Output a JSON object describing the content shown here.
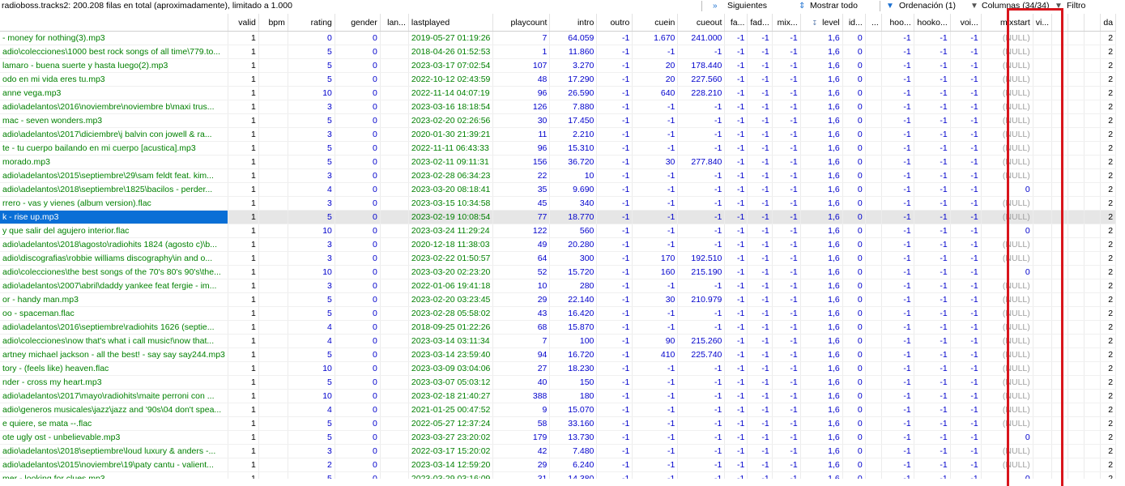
{
  "toolbar": {
    "status": "radioboss.tracks2: 200.208 filas en total (aproximadamente), limitado a 1.000",
    "next_label": "Siguientes",
    "show_all_label": "Mostrar todo",
    "sort_label": "Ordenación (1)",
    "columns_label": "Columnas (34/34)",
    "filter_label": "Filtro",
    "next_icon": "double-chevron-right-icon",
    "show_all_icon": "up-down-arrows-icon",
    "sort_icon": "funnel-icon",
    "columns_icon": "dropdown-triangle-icon",
    "filter_icon": "dropdown-triangle-icon"
  },
  "colors": {
    "accent_highlight": "#d9151c",
    "selection": "#0a6fd6",
    "text_filename": "#008000",
    "text_number": "#0000cc",
    "null_text": "#a0a0a0"
  },
  "columns": [
    "",
    "valid",
    "bpm",
    "rating",
    "gender",
    "lan...",
    "lastplayed",
    "playcount",
    "intro",
    "outro",
    "cuein",
    "cueout",
    "fa...",
    "fad...",
    "mix...",
    "level",
    "id...",
    "...",
    "hoo...",
    "hooko...",
    "voi...",
    "mixstart",
    "vi...",
    "",
    "",
    "",
    "da"
  ],
  "level_sort_icon": "sort-za-icon",
  "rows": [
    [
      "- money for nothing(3).mp3",
      "1",
      "",
      "0",
      "0",
      "",
      "2019-05-27 01:19:26",
      "7",
      "64.059",
      "-1",
      "1.670",
      "241.000",
      "-1",
      "-1",
      "-1",
      "1,6",
      "0",
      "",
      "-1",
      "-1",
      "-1",
      "(NULL)",
      "",
      "",
      "",
      "",
      "2"
    ],
    [
      "adio\\colecciones\\1000 best rock songs of all time\\779.to...",
      "1",
      "",
      "5",
      "0",
      "",
      "2018-04-26 01:52:53",
      "1",
      "11.860",
      "-1",
      "-1",
      "-1",
      "-1",
      "-1",
      "-1",
      "1,6",
      "0",
      "",
      "-1",
      "-1",
      "-1",
      "(NULL)",
      "",
      "",
      "",
      "",
      "2"
    ],
    [
      "lamaro - buena suerte y hasta luego(2).mp3",
      "1",
      "",
      "5",
      "0",
      "",
      "2023-03-17 07:02:54",
      "107",
      "3.270",
      "-1",
      "20",
      "178.440",
      "-1",
      "-1",
      "-1",
      "1,6",
      "0",
      "",
      "-1",
      "-1",
      "-1",
      "(NULL)",
      "",
      "",
      "",
      "",
      "2"
    ],
    [
      "odo en mi vida eres tu.mp3",
      "1",
      "",
      "5",
      "0",
      "",
      "2022-10-12 02:43:59",
      "48",
      "17.290",
      "-1",
      "20",
      "227.560",
      "-1",
      "-1",
      "-1",
      "1,6",
      "0",
      "",
      "-1",
      "-1",
      "-1",
      "(NULL)",
      "",
      "",
      "",
      "",
      "2"
    ],
    [
      "anne vega.mp3",
      "1",
      "",
      "10",
      "0",
      "",
      "2022-11-14 04:07:19",
      "96",
      "26.590",
      "-1",
      "640",
      "228.210",
      "-1",
      "-1",
      "-1",
      "1,6",
      "0",
      "",
      "-1",
      "-1",
      "-1",
      "(NULL)",
      "",
      "",
      "",
      "",
      "2"
    ],
    [
      "adio\\adelantos\\2016\\noviembre\\noviembre b\\maxi trus...",
      "1",
      "",
      "3",
      "0",
      "",
      "2023-03-16 18:18:54",
      "126",
      "7.880",
      "-1",
      "-1",
      "-1",
      "-1",
      "-1",
      "-1",
      "1,6",
      "0",
      "",
      "-1",
      "-1",
      "-1",
      "(NULL)",
      "",
      "",
      "",
      "",
      "2"
    ],
    [
      "mac - seven wonders.mp3",
      "1",
      "",
      "5",
      "0",
      "",
      "2023-02-20 02:26:56",
      "30",
      "17.450",
      "-1",
      "-1",
      "-1",
      "-1",
      "-1",
      "-1",
      "1,6",
      "0",
      "",
      "-1",
      "-1",
      "-1",
      "(NULL)",
      "",
      "",
      "",
      "",
      "2"
    ],
    [
      "adio\\adelantos\\2017\\diciembre\\j balvin con jowell & ra...",
      "1",
      "",
      "3",
      "0",
      "",
      "2020-01-30 21:39:21",
      "11",
      "2.210",
      "-1",
      "-1",
      "-1",
      "-1",
      "-1",
      "-1",
      "1,6",
      "0",
      "",
      "-1",
      "-1",
      "-1",
      "(NULL)",
      "",
      "",
      "",
      "",
      "2"
    ],
    [
      "te - tu cuerpo bailando en mi cuerpo [acustica].mp3",
      "1",
      "",
      "5",
      "0",
      "",
      "2022-11-11 06:43:33",
      "96",
      "15.310",
      "-1",
      "-1",
      "-1",
      "-1",
      "-1",
      "-1",
      "1,6",
      "0",
      "",
      "-1",
      "-1",
      "-1",
      "(NULL)",
      "",
      "",
      "",
      "",
      "2"
    ],
    [
      "morado.mp3",
      "1",
      "",
      "5",
      "0",
      "",
      "2023-02-11 09:11:31",
      "156",
      "36.720",
      "-1",
      "30",
      "277.840",
      "-1",
      "-1",
      "-1",
      "1,6",
      "0",
      "",
      "-1",
      "-1",
      "-1",
      "(NULL)",
      "",
      "",
      "",
      "",
      "2"
    ],
    [
      "adio\\adelantos\\2015\\septiembre\\29\\sam feldt feat. kim...",
      "1",
      "",
      "3",
      "0",
      "",
      "2023-02-28 06:34:23",
      "22",
      "10",
      "-1",
      "-1",
      "-1",
      "-1",
      "-1",
      "-1",
      "1,6",
      "0",
      "",
      "-1",
      "-1",
      "-1",
      "(NULL)",
      "",
      "",
      "",
      "",
      "2"
    ],
    [
      "adio\\adelantos\\2018\\septiembre\\1825\\bacilos - perder...",
      "1",
      "",
      "4",
      "0",
      "",
      "2023-03-20 08:18:41",
      "35",
      "9.690",
      "-1",
      "-1",
      "-1",
      "-1",
      "-1",
      "-1",
      "1,6",
      "0",
      "",
      "-1",
      "-1",
      "-1",
      "0",
      "",
      "",
      "",
      "",
      "2"
    ],
    [
      "rrero - vas y vienes (album version).flac",
      "1",
      "",
      "3",
      "0",
      "",
      "2023-03-15 10:34:58",
      "45",
      "340",
      "-1",
      "-1",
      "-1",
      "-1",
      "-1",
      "-1",
      "1,6",
      "0",
      "",
      "-1",
      "-1",
      "-1",
      "(NULL)",
      "",
      "",
      "",
      "",
      "2"
    ],
    [
      "k - rise up.mp3",
      "1",
      "",
      "5",
      "0",
      "",
      "2023-02-19 10:08:54",
      "77",
      "18.770",
      "-1",
      "-1",
      "-1",
      "-1",
      "-1",
      "-1",
      "1,6",
      "0",
      "",
      "-1",
      "-1",
      "-1",
      "(NULL)",
      "",
      "",
      "",
      "",
      "2"
    ],
    [
      "y que salir del agujero interior.flac",
      "1",
      "",
      "10",
      "0",
      "",
      "2023-03-24 11:29:24",
      "122",
      "560",
      "-1",
      "-1",
      "-1",
      "-1",
      "-1",
      "-1",
      "1,6",
      "0",
      "",
      "-1",
      "-1",
      "-1",
      "0",
      "",
      "",
      "",
      "",
      "2"
    ],
    [
      "adio\\adelantos\\2018\\agosto\\radiohits 1824 (agosto c)\\b...",
      "1",
      "",
      "3",
      "0",
      "",
      "2020-12-18 11:38:03",
      "49",
      "20.280",
      "-1",
      "-1",
      "-1",
      "-1",
      "-1",
      "-1",
      "1,6",
      "0",
      "",
      "-1",
      "-1",
      "-1",
      "(NULL)",
      "",
      "",
      "",
      "",
      "2"
    ],
    [
      "adio\\discografias\\robbie williams discography\\in and o...",
      "1",
      "",
      "3",
      "0",
      "",
      "2023-02-22 01:50:57",
      "64",
      "300",
      "-1",
      "170",
      "192.510",
      "-1",
      "-1",
      "-1",
      "1,6",
      "0",
      "",
      "-1",
      "-1",
      "-1",
      "(NULL)",
      "",
      "",
      "",
      "",
      "2"
    ],
    [
      "adio\\colecciones\\the best songs of the 70's 80's 90's\\the...",
      "1",
      "",
      "10",
      "0",
      "",
      "2023-03-20 02:23:20",
      "52",
      "15.720",
      "-1",
      "160",
      "215.190",
      "-1",
      "-1",
      "-1",
      "1,6",
      "0",
      "",
      "-1",
      "-1",
      "-1",
      "0",
      "",
      "",
      "",
      "",
      "2"
    ],
    [
      "adio\\adelantos\\2007\\abril\\daddy yankee feat fergie - im...",
      "1",
      "",
      "3",
      "0",
      "",
      "2022-01-06 19:41:18",
      "10",
      "280",
      "-1",
      "-1",
      "-1",
      "-1",
      "-1",
      "-1",
      "1,6",
      "0",
      "",
      "-1",
      "-1",
      "-1",
      "(NULL)",
      "",
      "",
      "",
      "",
      "2"
    ],
    [
      "or - handy man.mp3",
      "1",
      "",
      "5",
      "0",
      "",
      "2023-02-20 03:23:45",
      "29",
      "22.140",
      "-1",
      "30",
      "210.979",
      "-1",
      "-1",
      "-1",
      "1,6",
      "0",
      "",
      "-1",
      "-1",
      "-1",
      "(NULL)",
      "",
      "",
      "",
      "",
      "2"
    ],
    [
      "oo - spaceman.flac",
      "1",
      "",
      "5",
      "0",
      "",
      "2023-02-28 05:58:02",
      "43",
      "16.420",
      "-1",
      "-1",
      "-1",
      "-1",
      "-1",
      "-1",
      "1,6",
      "0",
      "",
      "-1",
      "-1",
      "-1",
      "(NULL)",
      "",
      "",
      "",
      "",
      "2"
    ],
    [
      "adio\\adelantos\\2016\\septiembre\\radiohits 1626 (septie...",
      "1",
      "",
      "4",
      "0",
      "",
      "2018-09-25 01:22:26",
      "68",
      "15.870",
      "-1",
      "-1",
      "-1",
      "-1",
      "-1",
      "-1",
      "1,6",
      "0",
      "",
      "-1",
      "-1",
      "-1",
      "(NULL)",
      "",
      "",
      "",
      "",
      "2"
    ],
    [
      "adio\\colecciones\\now that's what i call music!\\now that...",
      "1",
      "",
      "4",
      "0",
      "",
      "2023-03-14 03:11:34",
      "7",
      "100",
      "-1",
      "90",
      "215.260",
      "-1",
      "-1",
      "-1",
      "1,6",
      "0",
      "",
      "-1",
      "-1",
      "-1",
      "(NULL)",
      "",
      "",
      "",
      "",
      "2"
    ],
    [
      "artney michael jackson - all the best! - say say say244.mp3",
      "1",
      "",
      "5",
      "0",
      "",
      "2023-03-14 23:59:40",
      "94",
      "16.720",
      "-1",
      "410",
      "225.740",
      "-1",
      "-1",
      "-1",
      "1,6",
      "0",
      "",
      "-1",
      "-1",
      "-1",
      "(NULL)",
      "",
      "",
      "",
      "",
      "2"
    ],
    [
      "tory - (feels like) heaven.flac",
      "1",
      "",
      "10",
      "0",
      "",
      "2023-03-09 03:04:06",
      "27",
      "18.230",
      "-1",
      "-1",
      "-1",
      "-1",
      "-1",
      "-1",
      "1,6",
      "0",
      "",
      "-1",
      "-1",
      "-1",
      "(NULL)",
      "",
      "",
      "",
      "",
      "2"
    ],
    [
      "nder - cross my heart.mp3",
      "1",
      "",
      "5",
      "0",
      "",
      "2023-03-07 05:03:12",
      "40",
      "150",
      "-1",
      "-1",
      "-1",
      "-1",
      "-1",
      "-1",
      "1,6",
      "0",
      "",
      "-1",
      "-1",
      "-1",
      "(NULL)",
      "",
      "",
      "",
      "",
      "2"
    ],
    [
      "adio\\adelantos\\2017\\mayo\\radiohits\\maite perroni con ...",
      "1",
      "",
      "10",
      "0",
      "",
      "2023-02-18 21:40:27",
      "388",
      "180",
      "-1",
      "-1",
      "-1",
      "-1",
      "-1",
      "-1",
      "1,6",
      "0",
      "",
      "-1",
      "-1",
      "-1",
      "(NULL)",
      "",
      "",
      "",
      "",
      "2"
    ],
    [
      "adio\\generos musicales\\jazz\\jazz and '90s\\04 don't spea...",
      "1",
      "",
      "4",
      "0",
      "",
      "2021-01-25 00:47:52",
      "9",
      "15.070",
      "-1",
      "-1",
      "-1",
      "-1",
      "-1",
      "-1",
      "1,6",
      "0",
      "",
      "-1",
      "-1",
      "-1",
      "(NULL)",
      "",
      "",
      "",
      "",
      "2"
    ],
    [
      "e quiere, se mata --.flac",
      "1",
      "",
      "5",
      "0",
      "",
      "2022-05-27 12:37:24",
      "58",
      "33.160",
      "-1",
      "-1",
      "-1",
      "-1",
      "-1",
      "-1",
      "1,6",
      "0",
      "",
      "-1",
      "-1",
      "-1",
      "(NULL)",
      "",
      "",
      "",
      "",
      "2"
    ],
    [
      "ote ugly ost - unbelievable.mp3",
      "1",
      "",
      "5",
      "0",
      "",
      "2023-03-27 23:20:02",
      "179",
      "13.730",
      "-1",
      "-1",
      "-1",
      "-1",
      "-1",
      "-1",
      "1,6",
      "0",
      "",
      "-1",
      "-1",
      "-1",
      "0",
      "",
      "",
      "",
      "",
      "2"
    ],
    [
      "adio\\adelantos\\2018\\septiembre\\loud luxury & anders -...",
      "1",
      "",
      "3",
      "0",
      "",
      "2022-03-17 15:20:02",
      "42",
      "7.480",
      "-1",
      "-1",
      "-1",
      "-1",
      "-1",
      "-1",
      "1,6",
      "0",
      "",
      "-1",
      "-1",
      "-1",
      "(NULL)",
      "",
      "",
      "",
      "",
      "2"
    ],
    [
      "adio\\adelantos\\2015\\noviembre\\19\\paty cantu - valient...",
      "1",
      "",
      "2",
      "0",
      "",
      "2023-03-14 12:59:20",
      "29",
      "6.240",
      "-1",
      "-1",
      "-1",
      "-1",
      "-1",
      "-1",
      "1,6",
      "0",
      "",
      "-1",
      "-1",
      "-1",
      "(NULL)",
      "",
      "",
      "",
      "",
      "2"
    ],
    [
      "mer - looking for clues.mp3",
      "1",
      "",
      "5",
      "0",
      "",
      "2023-03-29 03:16:09",
      "31",
      "14.380",
      "-1",
      "-1",
      "-1",
      "-1",
      "-1",
      "-1",
      "1,6",
      "0",
      "",
      "-1",
      "-1",
      "-1",
      "0",
      "",
      "",
      "",
      "",
      "2"
    ]
  ],
  "selected_row": 13
}
